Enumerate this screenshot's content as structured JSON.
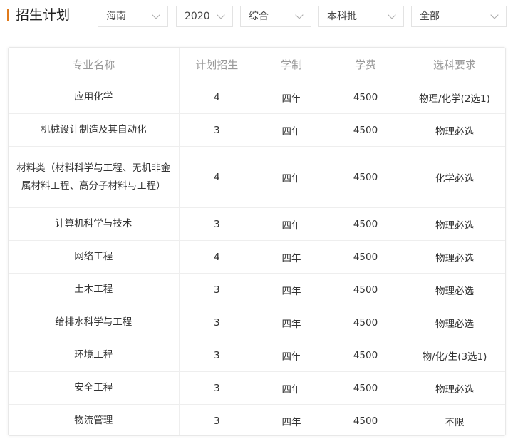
{
  "header": {
    "title": "招生计划",
    "filters": [
      {
        "value": "海南"
      },
      {
        "value": "2020"
      },
      {
        "value": "综合"
      },
      {
        "value": "本科批"
      },
      {
        "value": "全部"
      }
    ]
  },
  "colors": {
    "accent": "#e07a1b",
    "header_text": "#999999",
    "border": "#eeeeee"
  },
  "table": {
    "columns": [
      "专业名称",
      "计划招生",
      "学制",
      "学费",
      "选科要求"
    ],
    "rows": [
      {
        "major": "应用化学",
        "plan": "4",
        "duration": "四年",
        "tuition": "4500",
        "requirement": "物理/化学(2选1)"
      },
      {
        "major": "机械设计制造及其自动化",
        "plan": "3",
        "duration": "四年",
        "tuition": "4500",
        "requirement": "物理必选"
      },
      {
        "major": "材料类（材料科学与工程、无机非金属材料工程、高分子材料与工程）",
        "plan": "4",
        "duration": "四年",
        "tuition": "4500",
        "requirement": "化学必选"
      },
      {
        "major": "计算机科学与技术",
        "plan": "3",
        "duration": "四年",
        "tuition": "4500",
        "requirement": "物理必选"
      },
      {
        "major": "网络工程",
        "plan": "4",
        "duration": "四年",
        "tuition": "4500",
        "requirement": "物理必选"
      },
      {
        "major": "土木工程",
        "plan": "3",
        "duration": "四年",
        "tuition": "4500",
        "requirement": "物理必选"
      },
      {
        "major": "给排水科学与工程",
        "plan": "3",
        "duration": "四年",
        "tuition": "4500",
        "requirement": "物理必选"
      },
      {
        "major": "环境工程",
        "plan": "3",
        "duration": "四年",
        "tuition": "4500",
        "requirement": "物/化/生(3选1)"
      },
      {
        "major": "安全工程",
        "plan": "3",
        "duration": "四年",
        "tuition": "4500",
        "requirement": "物理必选"
      },
      {
        "major": "物流管理",
        "plan": "3",
        "duration": "四年",
        "tuition": "4500",
        "requirement": "不限"
      }
    ]
  }
}
